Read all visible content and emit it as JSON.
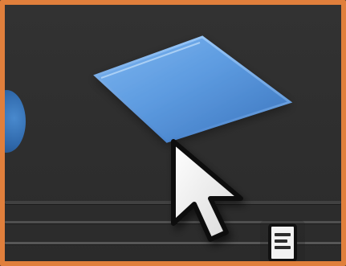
{
  "app": {
    "title": ""
  },
  "canvas": {
    "accent": "#e07f3c",
    "background": "#2b2b2b",
    "tile_color": "#5d9be0",
    "node_color": "#3a78c0"
  },
  "icons": {
    "cursor": "arrow-cursor-icon",
    "document": "document-icon",
    "tile": "blue-tile-icon",
    "node": "blue-node-icon"
  }
}
